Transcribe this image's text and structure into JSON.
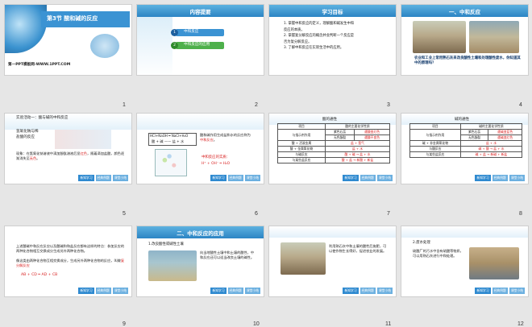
{
  "thumbnails": [
    {
      "number": "1",
      "title": "第3节  酸和碱的反应",
      "footer": "第一PPT模板网-WWW.1PPT.COM"
    },
    {
      "number": "2",
      "header": "内容提要",
      "items": [
        "中和反应",
        "中和反应的应用"
      ],
      "item_markers": [
        "1",
        "2"
      ]
    },
    {
      "number": "3",
      "header": "学习目标",
      "items": [
        "1.  掌握中和反应的定义，理解酸和碱发生中和",
        "     反应的本质。",
        "2.  掌握复分解反应的概念并会判断一个反应是",
        "     否为复分解反应。",
        "3.  了解中和反应在实际生活中的应用。"
      ]
    },
    {
      "number": "4",
      "header": "一、中和反应",
      "caption": "农业和工业上常用熟石灰来改良酸性土壤和处理酸性废水，你知道其中的原理吗？"
    },
    {
      "number": "5",
      "section": "实验活动一：酸与碱的中和反应",
      "labels": [
        "氢氧化钠与稀",
        "盐酸的反应"
      ],
      "observation_prefix": "现象：在氢氧化钠溶液中滴加酚酞溶液后显",
      "observation_red": "红色",
      "observation_mid": "，随着滴加盐酸，颜色逐渐消失至",
      "observation_end": "无色",
      "observation_suffix": "。"
    },
    {
      "number": "6",
      "equation": "HCl+NaOH ═ NaCl+H₂O",
      "scheme": "酸 + 碱 —— 盐 + 水",
      "note_prefix": "酸和碱作用生成盐和水的反应称为",
      "note_term": "中和反应",
      "note_suffix": "。",
      "essence_label": "中和反应的实质：",
      "essence_formula": "H⁺ + OH⁻ ═ H₂O"
    },
    {
      "number": "7",
      "table_title": "酸的通性",
      "rows": [
        [
          "项目",
          "酸的主要化学性质"
        ],
        [
          "与指示剂作用",
          "紫色石蕊",
          "遇酸变红色"
        ],
        [
          "",
          "无色酚酞",
          "遇酸不变色"
        ],
        [
          "酸 + 活泼金属",
          "盐 + 氢气"
        ],
        [
          "酸 + 金属氧化物",
          "盐 + 水"
        ],
        [
          "与碱反应",
          "酸 + 碱 → 盐 + 水"
        ],
        [
          "与某些盐反应",
          "酸 + 盐 → 新酸 + 新盐"
        ]
      ]
    },
    {
      "number": "8",
      "table_title": "碱的通性",
      "rows": [
        [
          "项目",
          "碱的主要化学性质"
        ],
        [
          "与指示剂作用",
          "紫色石蕊",
          "遇碱变蓝色"
        ],
        [
          "",
          "无色酚酞",
          "遇碱变红色"
        ],
        [
          "碱 + 非金属氧化物",
          "盐 + 水"
        ],
        [
          "与酸反应",
          "碱 + 酸 → 盐 + 水"
        ],
        [
          "与某些盐反应",
          "碱 + 盐 → 新碱 + 新盐"
        ]
      ]
    },
    {
      "number": "9",
      "para1": "上述酸碱中和反应反应以及酸碱和和盐反应都有这样的特点：参加反应的两种化合物相互交换成分生成另外两种化合物。",
      "para2": "像这类由两种化合物互相交换成分，生成另外两种化合物的反应，叫做",
      "para2_term": "复分解反应",
      "formula": "AB + CD ═ AD + CB"
    },
    {
      "number": "10",
      "header": "二、中和反应的应用",
      "sub": "1.改良酸性或碱性土壤",
      "body": "向当地酸性土壤中和土壤的酸性，中和反应还可以适当改良土壤的碱性。"
    },
    {
      "number": "11",
      "body": "利用熟石灰中和土壤的酸性后施肥，可以使作物生长得好，促进农业的发展。"
    },
    {
      "number": "12",
      "sub": "2.废水处理",
      "body": "硫酸厂的污水中含有硫酸等物质，可以用熟石灰进行中和处理。"
    }
  ],
  "mini_tabs": [
    "新知学习",
    "经典例题",
    "课堂小结"
  ],
  "colors": {
    "accent": "#2c84c4",
    "red": "#d81e1e"
  }
}
